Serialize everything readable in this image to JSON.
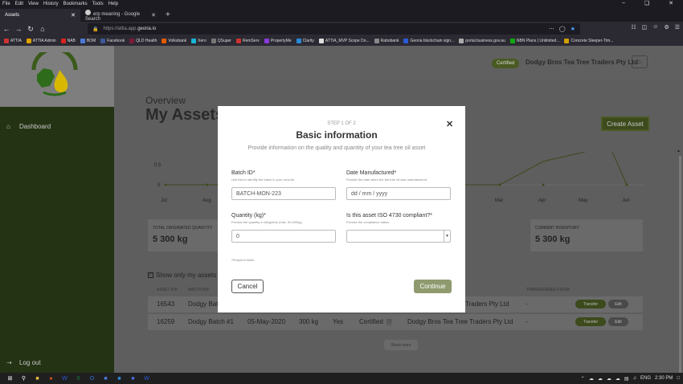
{
  "browser": {
    "menu": [
      "File",
      "Edit",
      "View",
      "History",
      "Bookmarks",
      "Tools",
      "Help"
    ],
    "tabs": [
      {
        "title": "Assets",
        "active": true
      },
      {
        "title": "erp meaning - Google Search",
        "active": false
      }
    ],
    "url_prefix": "https://attia.app.",
    "url_domain": "georia.io",
    "bookmarks": [
      "ATTIA",
      "ATTIA Admin",
      "NAB",
      "BOM",
      "Facebook",
      "QLD Health",
      "Volksbank",
      "Xero",
      "QSuper",
      "RemServ",
      "PropertyMe",
      "Clarity",
      "ATTIA_MVP Scope Do...",
      "Rabobank",
      "Georia blockchain sign...",
      "portal.business.gov.au",
      "NBN Plans | Unlimited...",
      "Concrete Sleeper-Tim..."
    ]
  },
  "sidebar": {
    "items": [
      {
        "label": "Dashboard",
        "icon": "home-icon"
      },
      {
        "label": "Log out",
        "icon": "logout-icon"
      }
    ]
  },
  "header": {
    "certified": "Certified",
    "company": "Dodgy Bros Tea Tree Traders Pty Ltd"
  },
  "page": {
    "overview": "Overview",
    "title": "My Assets",
    "create_button": "Create Asset"
  },
  "chart_data": {
    "type": "line",
    "x": [
      "Jul",
      "Aug",
      "Mar",
      "Apr",
      "May",
      "Jun"
    ],
    "y_ticks": [
      "0.5",
      "0"
    ],
    "accent": "#3c4a1c"
  },
  "cards": [
    {
      "title": "TOTAL ORIGINATED QUANTITY",
      "value": "5 300 kg"
    },
    {
      "title": "CURRENT INVENTORY",
      "value": "5 300 kg"
    }
  ],
  "filter": {
    "label": "Show only my assets"
  },
  "table": {
    "headers": [
      "ASSET ID#",
      "BATCH ID#",
      "TRANSFERRED FROM"
    ],
    "rows": [
      {
        "asset_id": "16543",
        "batch": "Dodgy Batc",
        "date": "",
        "qty": "",
        "iso": "",
        "status": "",
        "owner": "Traders Pty Ltd",
        "from": "-"
      },
      {
        "asset_id": "16259",
        "batch": "Dodgy Batch #1",
        "date": "05-May-2020",
        "qty": "300 kg",
        "iso": "Yes",
        "status": "Certified",
        "owner": "Dodgy Bros Tea Tree Traders Pty Ltd",
        "from": "-"
      }
    ],
    "transfer_label": "Transfer",
    "edit_label": "Edit",
    "show_more": "Show more"
  },
  "modal": {
    "step": "STEP 1 OF 2",
    "title": "Basic information",
    "subtitle": "Provide information on the quality and quantity of your tea tree oil asset",
    "batch_label": "Batch ID*",
    "batch_help": "Use this to identify the batch in your records.",
    "batch_value": "BATCH-MON-223",
    "date_label": "Date Manufactured*",
    "date_help": "Provide the date when the tea tree oil was manufactured",
    "date_placeholder": "dd / mm / yyyy",
    "qty_label": "Quantity (kg)*",
    "qty_help": "Provide the quantity in kilograms (max. 50,000kg)",
    "qty_value": "0",
    "iso_label": "Is this asset ISO 4730 compliant?*",
    "iso_help": "Provide the compliance status",
    "required_note": "*Required fields",
    "cancel": "Cancel",
    "continue": "Continue"
  },
  "taskbar": {
    "language": "ENG",
    "time": "2:30 PM"
  }
}
